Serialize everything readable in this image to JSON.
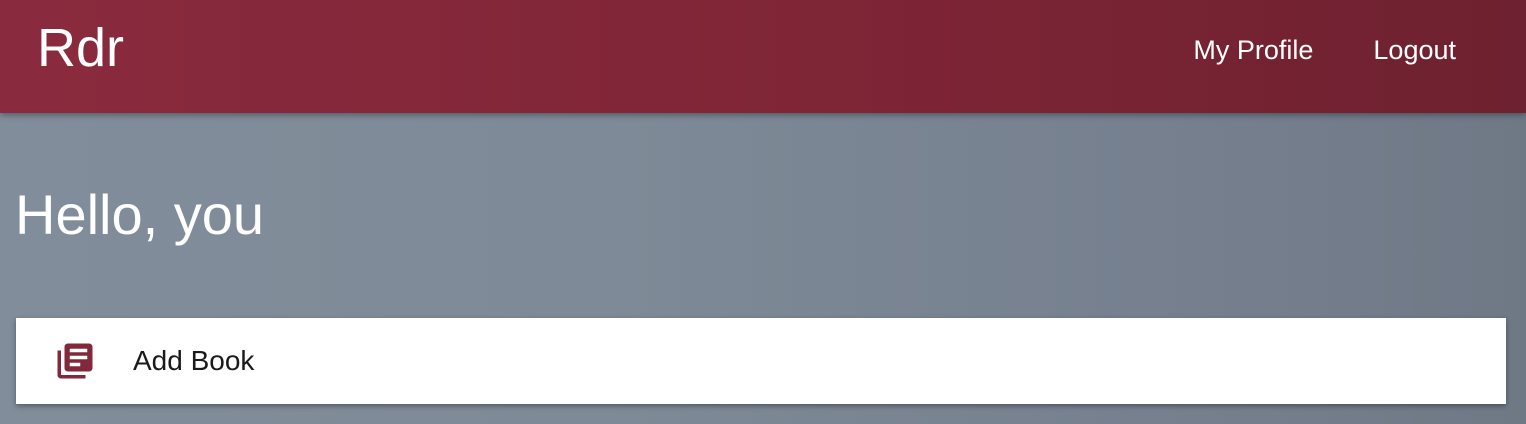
{
  "navbar": {
    "brand": "Rdr",
    "links": [
      {
        "label": "My Profile"
      },
      {
        "label": "Logout"
      }
    ]
  },
  "main": {
    "greeting": "Hello, you",
    "add_book": {
      "label": "Add Book",
      "icon": "library-books-icon"
    }
  },
  "colors": {
    "brand": "#82283a",
    "background": "#7b8795",
    "card": "#ffffff"
  }
}
